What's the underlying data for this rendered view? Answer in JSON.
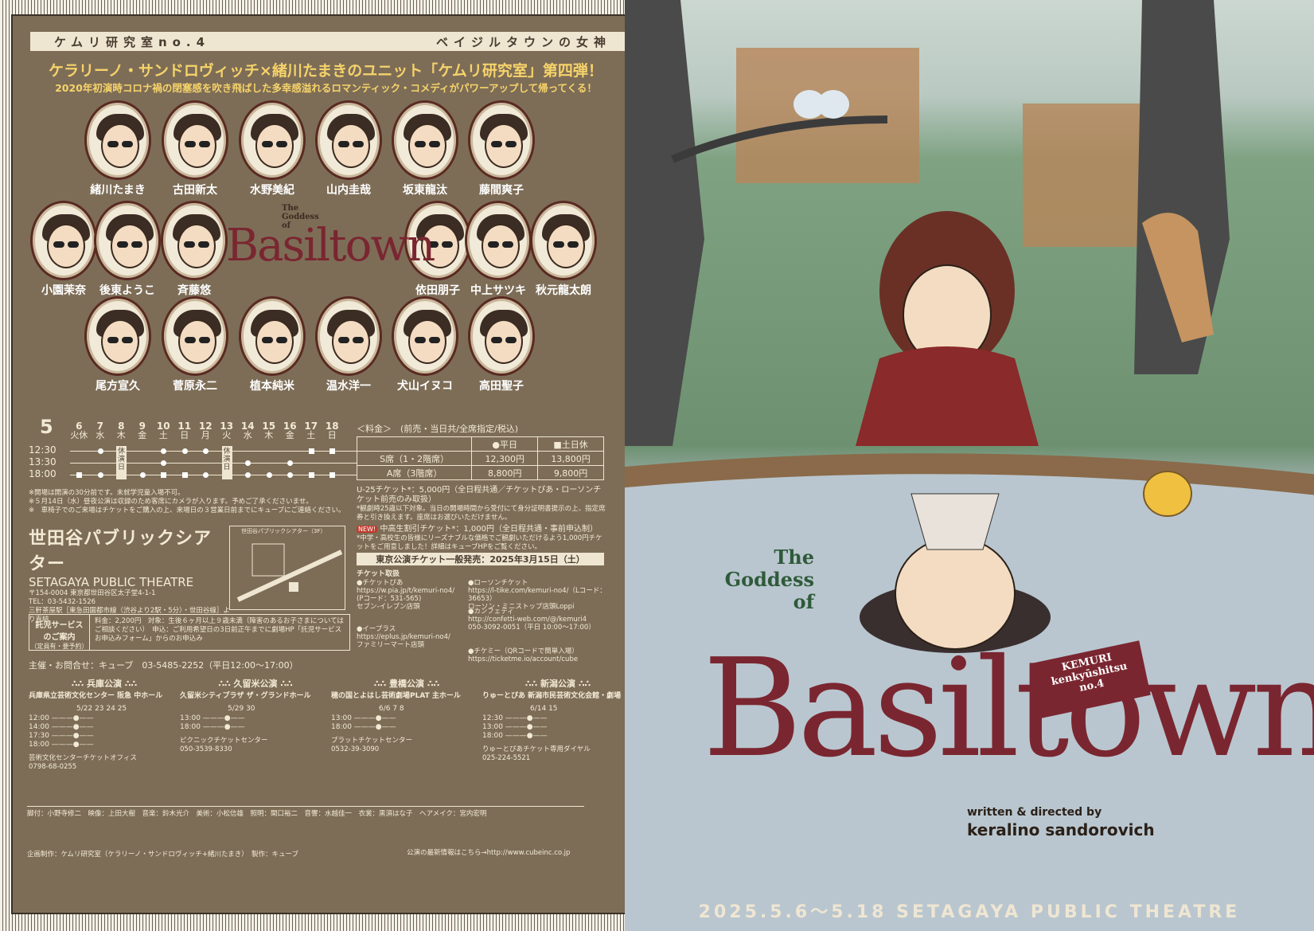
{
  "left": {
    "banner_left": "ケムリ研究室no.4",
    "banner_right": "ベイジルタウンの女神",
    "headline": "ケラリーノ・サンドロヴィッチ×緒川たまきのユニット「ケムリ研究室」第四弾！",
    "subline": "2020年初演時コロナ禍の閉塞感を吹き飛ばした多幸感溢れるロマンティック・コメディがパワーアップして帰ってくる！",
    "cast_row1": [
      "緒川たまき",
      "古田新太",
      "水野美紀",
      "山内圭哉",
      "坂東龍汰",
      "藤間爽子"
    ],
    "cast_row2_left": [
      "小園茉奈",
      "後東ようこ",
      "斉藤悠"
    ],
    "cast_row2_right": [
      "依田朋子",
      "中上サツキ",
      "秋元龍太朗"
    ],
    "cast_row3": [
      "尾方宣久",
      "菅原永二",
      "植本純米",
      "温水洋一",
      "犬山イヌコ",
      "高田聖子"
    ],
    "logo_small_title": "The Goddess of",
    "logo_small_word": "Basiltown",
    "schedule": {
      "month": "5",
      "days": [
        {
          "d": "6",
          "w": "火休"
        },
        {
          "d": "7",
          "w": "水"
        },
        {
          "d": "8",
          "w": "木"
        },
        {
          "d": "9",
          "w": "金"
        },
        {
          "d": "10",
          "w": "土"
        },
        {
          "d": "11",
          "w": "日"
        },
        {
          "d": "12",
          "w": "月"
        },
        {
          "d": "13",
          "w": "火"
        },
        {
          "d": "14",
          "w": "水"
        },
        {
          "d": "15",
          "w": "木"
        },
        {
          "d": "16",
          "w": "金"
        },
        {
          "d": "17",
          "w": "土"
        },
        {
          "d": "18",
          "w": "日"
        }
      ],
      "times": [
        "12:30",
        "13:30",
        "18:00"
      ],
      "rest_label": "休演日"
    },
    "notes": [
      "※開場は開演の30分前です。未就学児童入場不可。",
      "※５月14日（水）昼夜公演は収録のため客席にカメラが入ります。予めご了承くださいませ。",
      "※　車椅子でのご来場はチケットをご購入の上、来場日の３営業日前までにキューブにご連絡ください。"
    ],
    "price": {
      "title": "＜料金＞　(前売・当日共/全席指定/税込)",
      "col_weekday": "●平日",
      "col_weekend": "■土日休",
      "rows": [
        [
          "S席（1・2階席）",
          "12,300円",
          "13,800円"
        ],
        [
          "A席（3階席）",
          "8,800円",
          "9,800円"
        ]
      ],
      "u25": "U-25チケット*：5,000円（全日程共通／チケットぴあ・ローソンチケット前売のみ取扱）",
      "u25_note": "*観劇時25歳以下対象。当日の開場時間から受付にて身分証明書提示の上、指定席券と引き換えます。座席はお選びいただけません。",
      "student": "中高生割引チケット*：1,000円（全日程共通・事前申込制）",
      "student_note": "*中学・高校生の皆様にリーズナブルな価格でご観劇いただけるよう1,000円チケットをご用意しました！詳細はキューブHPをご覧ください。",
      "new_badge": "NEW!",
      "onsale": "東京公演チケット一般発売：2025年3月15日（土）"
    },
    "venue": {
      "name_jp": "世田谷パブリックシアター",
      "name_en": "SETAGAYA PUBLIC THEATRE",
      "address": "〒154-0004 東京都世田谷区太子堂4-1-1",
      "tel": "TEL：03-5432-1526",
      "access": "三軒茶屋駅［東急田園都市線（渋谷より2駅・5分）・世田谷線］より直結",
      "map_label": "世田谷パブリックシアター（3F）"
    },
    "child": {
      "label": "託児サービス\nのご案内",
      "sub": "（定員有・要予約）",
      "text": "料金：2,200円　対象：生後６ヶ月以上９歳未満（障害のあるお子さまについてはご相談ください）　申込：ご利用希望日の3日前正午までに劇場HP「託児サービスお申込みフォーム」からのお申込み"
    },
    "contact": "主催・お問合せ：キューブ　03-5485-2252（平日12:00～17:00）",
    "tickets": {
      "title": "チケット取扱",
      "items": [
        "●チケットぴあ\nhttps://w.pia.jp/t/kemuri-no4/\n(Pコード：531-565)\nセブン-イレブン店頭",
        "●イープラス\nhttps://eplus.jp/kemuri-no4/\nファミリーマート店頭",
        "●ローソンチケット\nhttps://l-tike.com/kemuri-no4/（Lコード：36653）\nローソン・ミニストップ店頭Loppi",
        "●カンフェティ\nhttp://confetti-web.com/@/kemuri4\n050-3092-0051（平日 10:00～17:00）",
        "●チケミー（QRコードで簡単入場）\nhttps://ticketme.io/account/cube"
      ]
    },
    "tours": [
      {
        "name": "兵庫公演",
        "venue": "兵庫県立芸術文化センター 阪急 中ホール",
        "dates": "5/22 23 24 25",
        "times": [
          "12:00",
          "14:00",
          "17:30",
          "18:00"
        ],
        "contact": "芸術文化センターチケットオフィス\n0798-68-0255"
      },
      {
        "name": "久留米公演",
        "venue": "久留米シティプラザ ザ・グランドホール",
        "dates": "5/29 30",
        "times": [
          "13:00",
          "18:00"
        ],
        "contact": "ピクニックチケットセンター\n050-3539-8330"
      },
      {
        "name": "豊橋公演",
        "venue": "穂の国とよはし芸術劇場PLAT 主ホール",
        "dates": "6/6 7 8",
        "times": [
          "13:00",
          "18:00"
        ],
        "contact": "プラットチケットセンター\n0532-39-3090"
      },
      {
        "name": "新潟公演",
        "venue": "りゅーとぴあ 新潟市民芸術文化会館・劇場",
        "dates": "6/14 15",
        "times": [
          "12:30",
          "13:00",
          "18:00"
        ],
        "contact": "りゅーとぴあチケット専用ダイヤル\n025-224-5521"
      }
    ],
    "staff": "脚付：小野寺修二　映像：上田大樹　音楽：鈴木光介　美術：小松信雄　照明：関口裕二　音響：水越佳一　衣裳：黒須はな子　ヘアメイク：宮内宏明",
    "producer": "企画制作：ケムリ研究室（ケラリーノ・サンドロヴィッチ+緒川たまき）　製作：キューブ",
    "url": "公演の最新情報はこちら→http://www.cubeinc.co.jp"
  },
  "right": {
    "title_small": "The\nGoddess\nof",
    "title_big": "Basiltown",
    "badge": "KEMURI\nkenkyūshitsu\nno.4",
    "credit_a": "written & directed by",
    "credit_b": "keralino sandorovich",
    "footer": "2025.5.6～5.18 SETAGAYA PUBLIC THEATRE"
  },
  "colors": {
    "panel": "#7d6d57",
    "accent": "#f6d36a",
    "title": "#7a2630",
    "green": "#2f5a3a"
  }
}
